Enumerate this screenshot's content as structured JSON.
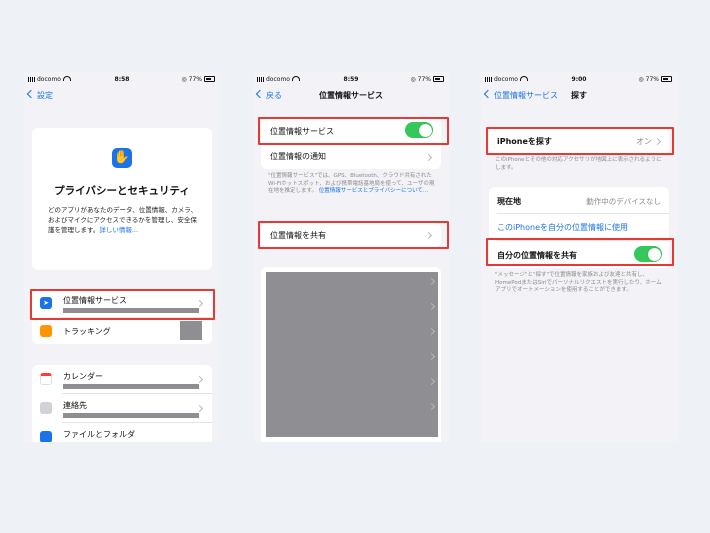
{
  "colors": {
    "accent": "#1a73e8",
    "highlight": "#e53935",
    "toggle_on": "#34c759",
    "redacted": "#8e8e93"
  },
  "screen1": {
    "status": {
      "carrier": "docomo",
      "time": "8:58",
      "battery": "77%"
    },
    "back_label": "設定",
    "hero": {
      "title": "プライバシーとセキュリティ",
      "desc": "どのアプリがあなたのデータ、位置情報、カメラ、およびマイクにアクセスできるかを管理し、安全保護を管理します。",
      "link": "詳しい情報..."
    },
    "items": [
      {
        "label": "位置情報サービス",
        "icon": "location-arrow-icon"
      },
      {
        "label": "トラッキング",
        "icon": "tracking-icon"
      },
      {
        "label": "カレンダー",
        "icon": "calendar-icon"
      },
      {
        "label": "連絡先",
        "icon": "contacts-icon"
      },
      {
        "label": "ファイルとフォルダ",
        "icon": "folder-icon"
      }
    ]
  },
  "screen2": {
    "status": {
      "carrier": "docomo",
      "time": "8:59",
      "battery": "77%"
    },
    "back_label": "戻る",
    "title": "位置情報サービス",
    "location_services": "位置情報サービス",
    "location_alerts": "位置情報の通知",
    "footnote": "\"位置情報サービス\"では、GPS、Bluetooth、クラウド共有されたWi-Fiホットスポット、および携帯電話基地局を使って、ユーザの現在地を推定します。",
    "footnote_link": "位置情報サービスとプライバシーについて...",
    "share_location": "位置情報を共有"
  },
  "screen3": {
    "status": {
      "carrier": "docomo",
      "time": "9:00",
      "battery": "77%"
    },
    "back_label": "位置情報サービス",
    "title": "探す",
    "find_iphone": "iPhoneを探す",
    "find_iphone_value": "オン",
    "find_note": "このiPhoneとその他の対応アクセサリが地図上に表示されるようにします。",
    "current_location": "現在地",
    "current_location_value": "動作中のデバイスなし",
    "use_this_iphone": "このiPhoneを自分の位置情報に使用",
    "share_my_location": "自分の位置情報を共有",
    "share_note": "\"メッセージ\"と\"探す\"で位置情報を家族および友達と共有し、HomePodまたはSiriでパーソナルリクエストを実行したり、ホームアプリでオートメーションを使用することができます。"
  }
}
